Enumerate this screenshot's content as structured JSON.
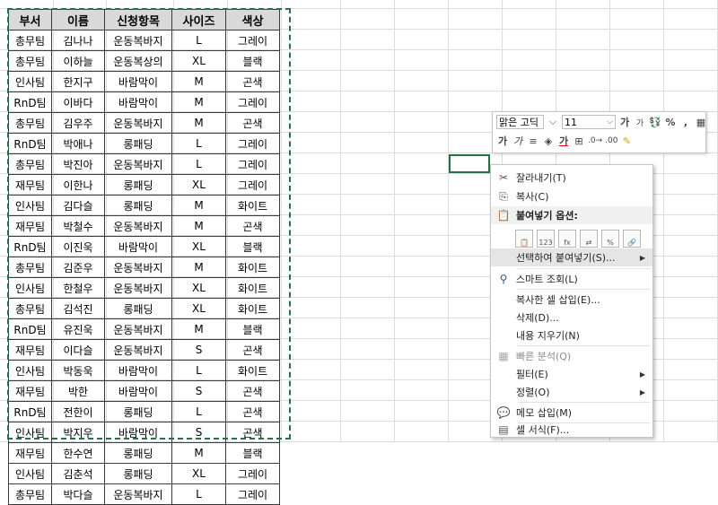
{
  "table": {
    "headers": [
      "부서",
      "이름",
      "신청항목",
      "사이즈",
      "색상"
    ],
    "rows": [
      [
        "총무팀",
        "김나나",
        "운동복바지",
        "L",
        "그레이"
      ],
      [
        "총무팀",
        "이하늘",
        "운동복상의",
        "XL",
        "블랙"
      ],
      [
        "인사팀",
        "한지구",
        "바람막이",
        "M",
        "곤색"
      ],
      [
        "RnD팀",
        "이바다",
        "바람막이",
        "M",
        "그레이"
      ],
      [
        "총무팀",
        "김우주",
        "운동복바지",
        "M",
        "곤색"
      ],
      [
        "RnD팀",
        "박애나",
        "롱패딩",
        "L",
        "그레이"
      ],
      [
        "총무팀",
        "박진아",
        "운동복바지",
        "L",
        "그레이"
      ],
      [
        "재무팀",
        "이한나",
        "롱패딩",
        "XL",
        "그레이"
      ],
      [
        "인사팀",
        "김다슬",
        "롱패딩",
        "M",
        "화이트"
      ],
      [
        "재무팀",
        "박철수",
        "운동복바지",
        "M",
        "곤색"
      ],
      [
        "RnD팀",
        "이진욱",
        "바람막이",
        "XL",
        "블랙"
      ],
      [
        "총무팀",
        "김준우",
        "운동복바지",
        "M",
        "화이트"
      ],
      [
        "인사팀",
        "한철우",
        "운동복바지",
        "XL",
        "화이트"
      ],
      [
        "총무팀",
        "김석진",
        "롱패딩",
        "XL",
        "화이트"
      ],
      [
        "RnD팀",
        "유진욱",
        "운동복바지",
        "M",
        "블랙"
      ],
      [
        "재무팀",
        "이다슬",
        "운동복바지",
        "S",
        "곤색"
      ],
      [
        "인사팀",
        "박동욱",
        "바람막이",
        "L",
        "화이트"
      ],
      [
        "재무팀",
        "박한",
        "바람막이",
        "S",
        "곤색"
      ],
      [
        "RnD팀",
        "전한이",
        "롱패딩",
        "L",
        "곤색"
      ],
      [
        "인사팀",
        "박지우",
        "바람막이",
        "S",
        "곤색"
      ],
      [
        "재무팀",
        "한수연",
        "롱패딩",
        "M",
        "블랙"
      ],
      [
        "인사팀",
        "김춘석",
        "롱패딩",
        "XL",
        "그레이"
      ],
      [
        "총무팀",
        "박다슬",
        "운동복바지",
        "L",
        "그레이"
      ]
    ]
  },
  "mini_toolbar": {
    "font": "맑은 고딕",
    "size": "11",
    "grow_font": "가",
    "shrink_font": "가",
    "percent": "%",
    "comma": ",",
    "bold": "가",
    "italic": "가",
    "font_color_letter": "가"
  },
  "context_menu": {
    "cut": "잘라내기(T)",
    "copy": "복사(C)",
    "paste_options": "붙여넣기 옵션:",
    "paste_special": "선택하여 붙여넣기(S)...",
    "smart_lookup": "스마트 조회(L)",
    "insert_copied": "복사한 셀 삽입(E)...",
    "delete": "삭제(D)...",
    "clear": "내용 지우기(N)",
    "quick_analysis": "빠른 분석(Q)",
    "filter": "필터(E)",
    "sort": "정렬(O)",
    "insert_comment": "메모 삽입(M)",
    "format_cells": "셀 서식(F)..."
  },
  "colors": {
    "accent": "#217346",
    "header_bg": "#d9d9d9",
    "menu_highlight": "#e5e5e5"
  }
}
